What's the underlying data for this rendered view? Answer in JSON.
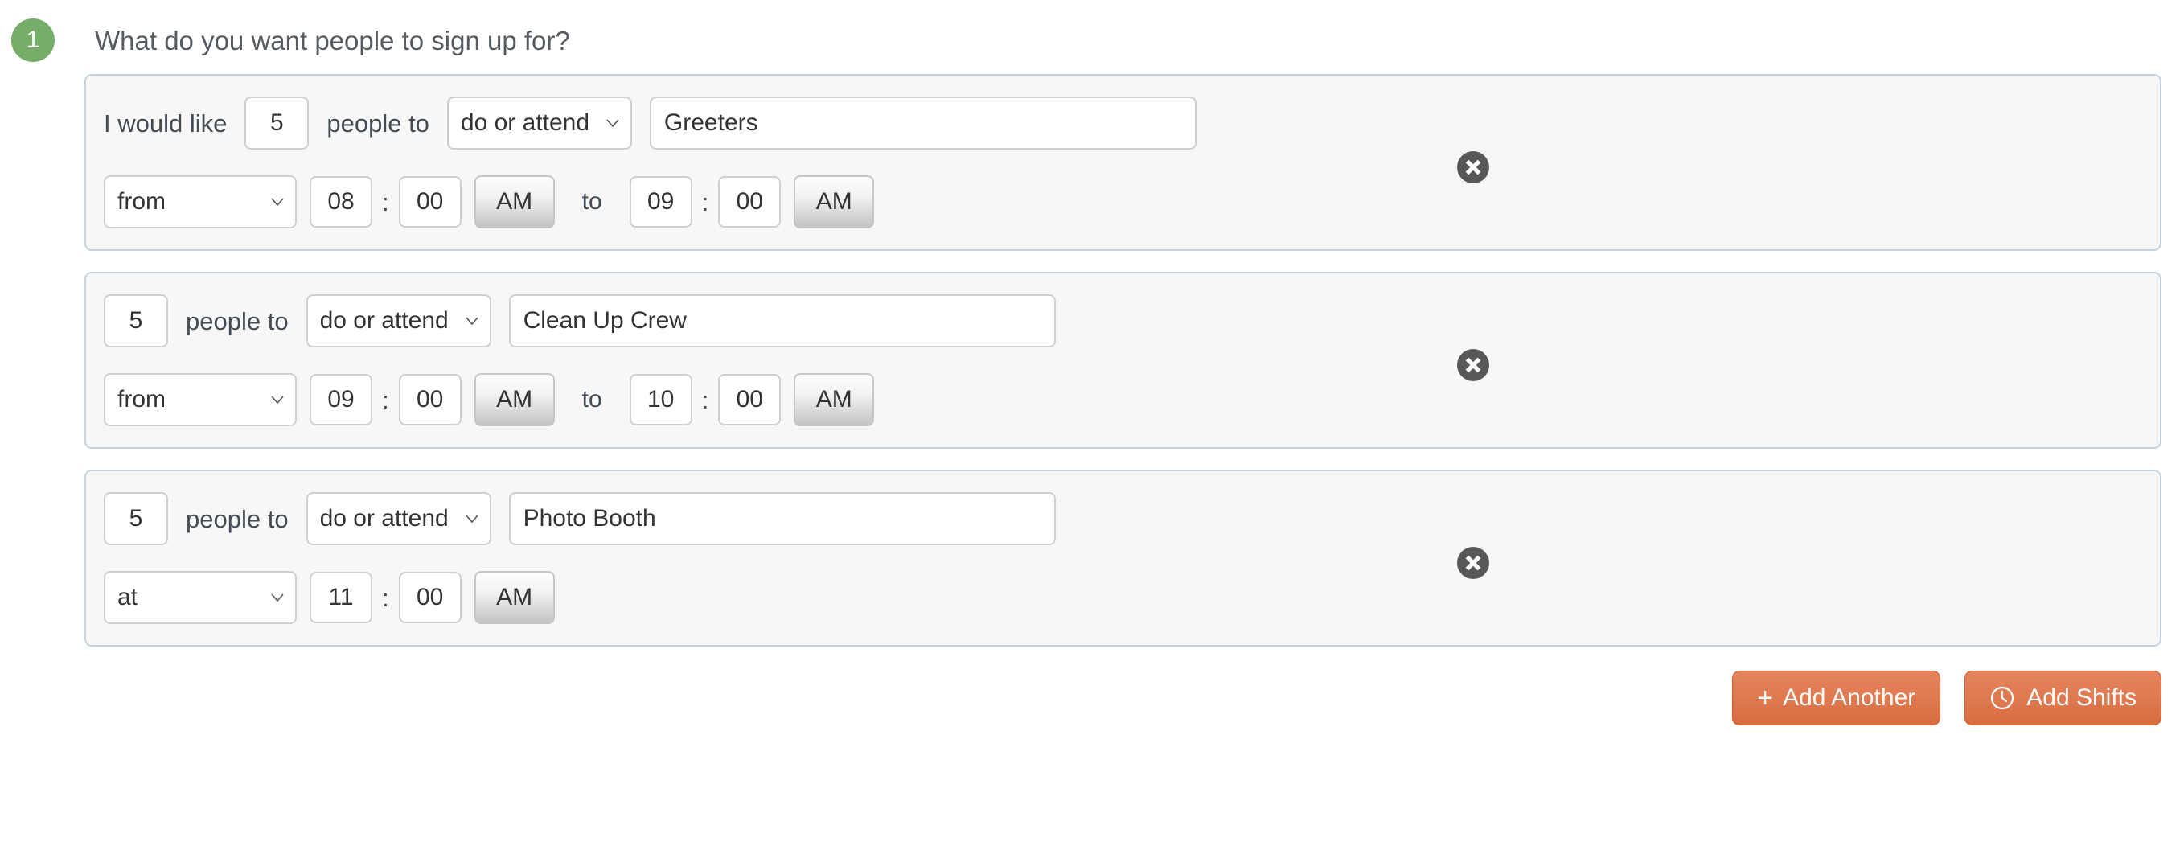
{
  "step": {
    "number": "1",
    "question": "What do you want people to sign up for?",
    "badge_color": "#75ad69"
  },
  "labels": {
    "i_would_like": "I would like",
    "people_to": "people to",
    "to": "to",
    "colon": ":"
  },
  "slots": [
    {
      "lead_label": "I would like",
      "quantity": "5",
      "people_to": "people to",
      "kind": "do or attend",
      "activity": "Greeters",
      "when_mode": "from",
      "start_hour": "08",
      "start_minute": "00",
      "start_meridiem": "AM",
      "to_label": "to",
      "end_hour": "09",
      "end_minute": "00",
      "end_meridiem": "AM",
      "has_end_time": true,
      "delete_icon": "close-circle-icon"
    },
    {
      "lead_label": "",
      "quantity": "5",
      "people_to": "people to",
      "kind": "do or attend",
      "activity": "Clean Up Crew",
      "when_mode": "from",
      "start_hour": "09",
      "start_minute": "00",
      "start_meridiem": "AM",
      "to_label": "to",
      "end_hour": "10",
      "end_minute": "00",
      "end_meridiem": "AM",
      "has_end_time": true,
      "delete_icon": "close-circle-icon"
    },
    {
      "lead_label": "",
      "quantity": "5",
      "people_to": "people to",
      "kind": "do or attend",
      "activity": "Photo Booth",
      "when_mode": "at",
      "start_hour": "11",
      "start_minute": "00",
      "start_meridiem": "AM",
      "to_label": "",
      "end_hour": "",
      "end_minute": "",
      "end_meridiem": "",
      "has_end_time": false,
      "delete_icon": "close-circle-icon"
    }
  ],
  "footer": {
    "add_another_label": "Add Another",
    "add_another_plus": "+",
    "add_shifts_label": "Add Shifts",
    "add_shifts_icon": "clock-icon",
    "button_color": "#d96c3e"
  }
}
